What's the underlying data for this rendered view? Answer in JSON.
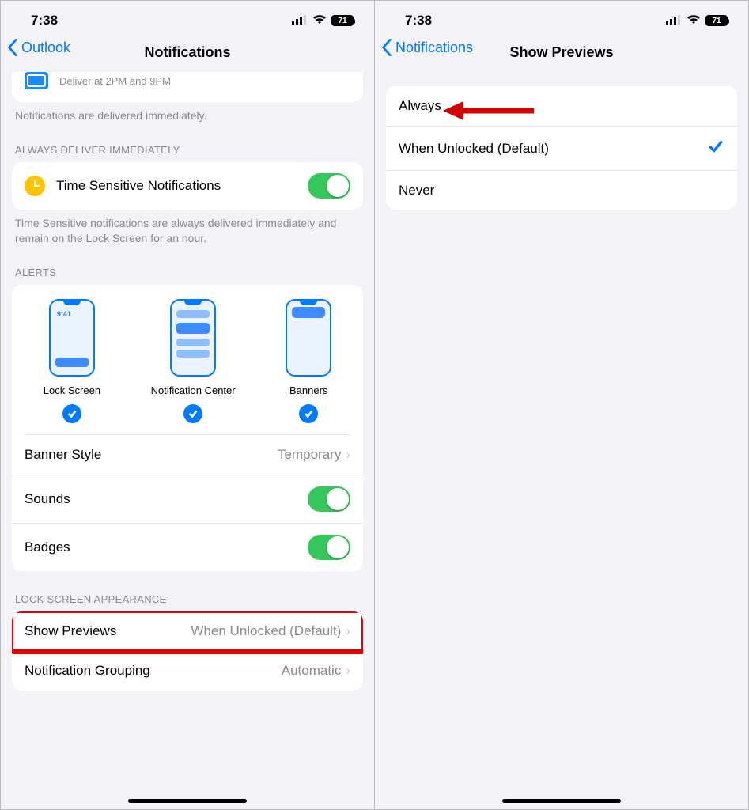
{
  "status": {
    "time": "7:38",
    "battery": "71"
  },
  "left": {
    "back": "Outlook",
    "title": "Notifications",
    "partial_subtext": "Deliver at 2PM and 9PM",
    "delivered_text": "Notifications are delivered immediately.",
    "section_always": "Always Deliver Immediately",
    "time_sensitive_label": "Time Sensitive Notifications",
    "time_sensitive_desc": "Time Sensitive notifications are always delivered immediately and remain on the Lock Screen for an hour.",
    "section_alerts": "Alerts",
    "alert_items": {
      "lock": "Lock Screen",
      "center": "Notification Center",
      "banners": "Banners",
      "lock_time": "9:41"
    },
    "banner_style": {
      "label": "Banner Style",
      "value": "Temporary"
    },
    "sounds": "Sounds",
    "badges": "Badges",
    "section_lock": "Lock Screen Appearance",
    "show_previews": {
      "label": "Show Previews",
      "value": "When Unlocked (Default)"
    },
    "grouping": {
      "label": "Notification Grouping",
      "value": "Automatic"
    }
  },
  "right": {
    "back": "Notifications",
    "title": "Show Previews",
    "options": {
      "always": "Always",
      "unlocked": "When Unlocked (Default)",
      "never": "Never"
    }
  }
}
